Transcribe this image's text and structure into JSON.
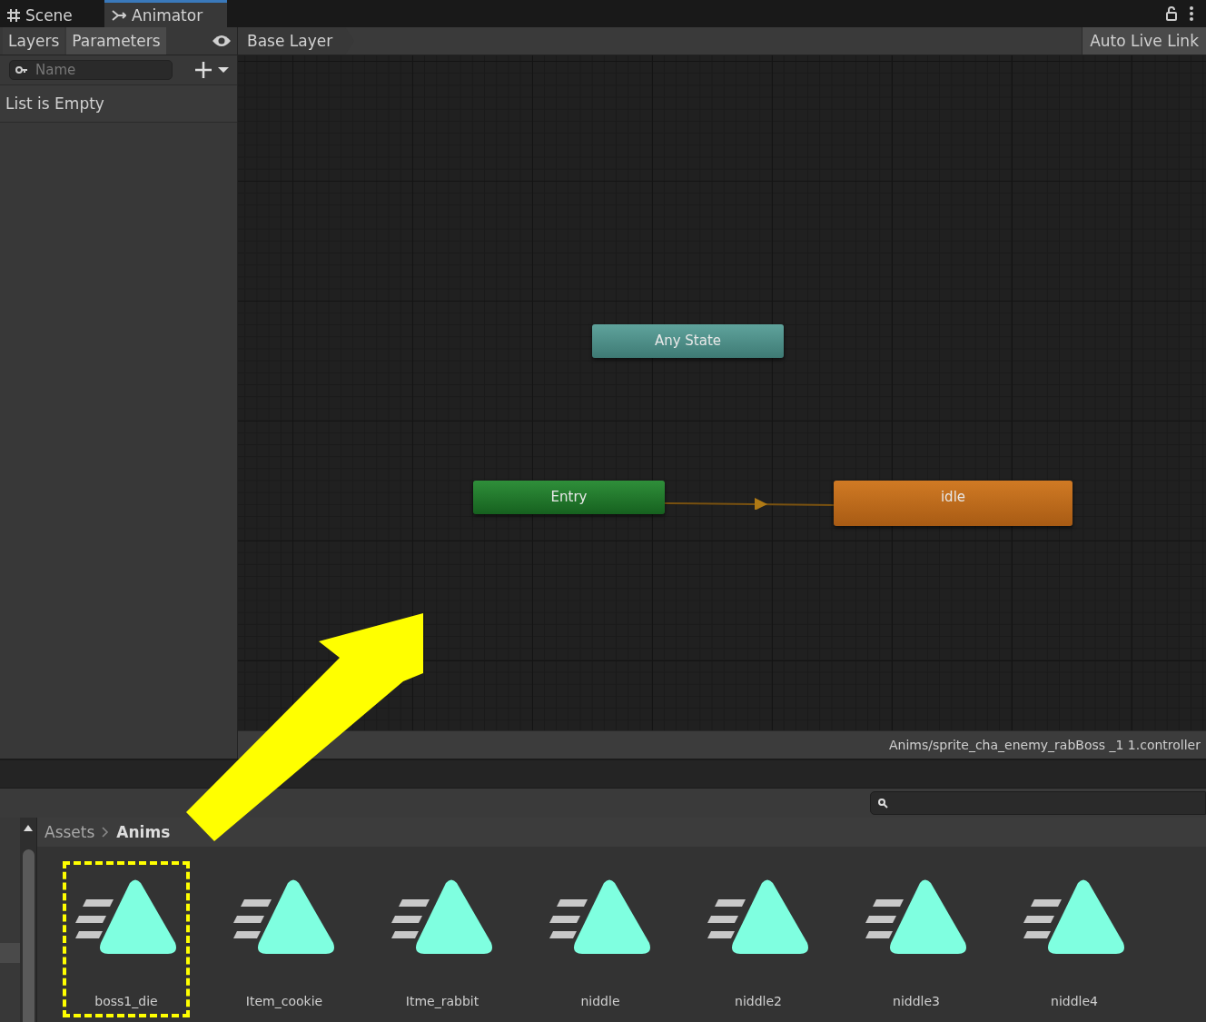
{
  "window_tabs": [
    {
      "label": "Scene",
      "kind": "grid",
      "selected": false
    },
    {
      "label": "Animator",
      "kind": "branch",
      "selected": true
    }
  ],
  "sidebar": {
    "tabs": [
      {
        "label": "Layers",
        "selected": false
      },
      {
        "label": "Parameters",
        "selected": true
      }
    ],
    "search": {
      "placeholder": "Name"
    },
    "empty_message": "List is Empty"
  },
  "graph": {
    "breadcrumb": "Base Layer",
    "live_link_button": "Auto Live Link",
    "nodes": [
      {
        "kind": "any",
        "label": "Any State"
      },
      {
        "kind": "entry",
        "label": "Entry"
      },
      {
        "kind": "state",
        "label": "idle"
      }
    ],
    "status": "Anims/sprite_cha_enemy_rabBoss _1 1.controller"
  },
  "project": {
    "breadcrumb": [
      {
        "label": "Assets",
        "current": false
      },
      {
        "label": "Anims",
        "current": true
      }
    ],
    "assets": [
      {
        "label": "boss1_die",
        "highlighted": true
      },
      {
        "label": "Item_cookie",
        "highlighted": false
      },
      {
        "label": "Itme_rabbit",
        "highlighted": false
      },
      {
        "label": "niddle",
        "highlighted": false
      },
      {
        "label": "niddle2",
        "highlighted": false
      },
      {
        "label": "niddle3",
        "highlighted": false
      },
      {
        "label": "niddle4",
        "highlighted": false
      }
    ]
  }
}
